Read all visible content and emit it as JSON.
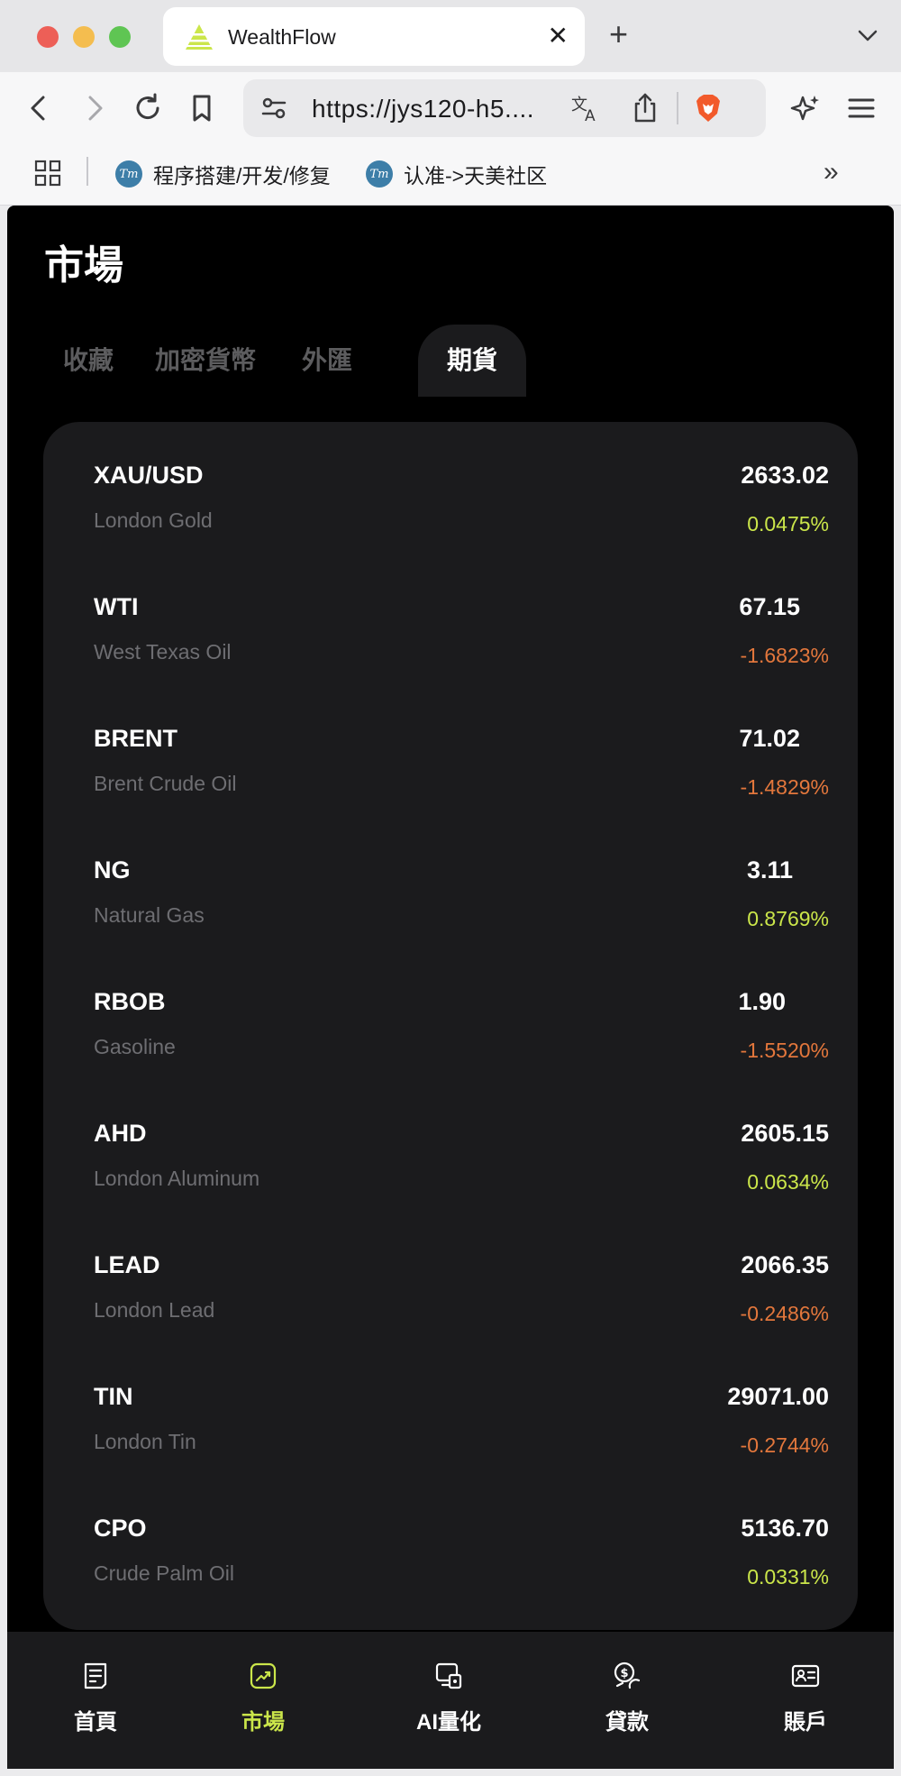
{
  "browser": {
    "tab_title": "WealthFlow",
    "url": "https://jys120-h5....",
    "bookmarks": [
      {
        "label": "程序搭建/开发/修复",
        "favicon_text": "Tm"
      },
      {
        "label": "认准->天美社区",
        "favicon_text": "Tm"
      }
    ]
  },
  "page": {
    "title": "市場",
    "tabs": [
      {
        "label": "收藏",
        "active": false
      },
      {
        "label": "加密貨幣",
        "active": false
      },
      {
        "label": "外匯",
        "active": false
      },
      {
        "label": "期貨",
        "active": true
      }
    ]
  },
  "colors": {
    "accent": "#cbe64a",
    "up": "#cbe64a",
    "down": "#e3773c",
    "background": "#000000",
    "card": "#1b1b1d"
  },
  "market": {
    "rows": [
      {
        "symbol": "XAU/USD",
        "name": "London Gold",
        "price": "2633.02",
        "change": "0.0475%",
        "direction": "up"
      },
      {
        "symbol": "WTI",
        "name": "West Texas Oil",
        "price": "67.15",
        "change": "-1.6823%",
        "direction": "down"
      },
      {
        "symbol": "BRENT",
        "name": "Brent Crude Oil",
        "price": "71.02",
        "change": "-1.4829%",
        "direction": "down"
      },
      {
        "symbol": "NG",
        "name": "Natural Gas",
        "price": "3.11",
        "change": "0.8769%",
        "direction": "up"
      },
      {
        "symbol": "RBOB",
        "name": "Gasoline",
        "price": "1.90",
        "change": "-1.5520%",
        "direction": "down"
      },
      {
        "symbol": "AHD",
        "name": "London Aluminum",
        "price": "2605.15",
        "change": "0.0634%",
        "direction": "up"
      },
      {
        "symbol": "LEAD",
        "name": "London Lead",
        "price": "2066.35",
        "change": "-0.2486%",
        "direction": "down"
      },
      {
        "symbol": "TIN",
        "name": "London Tin",
        "price": "29071.00",
        "change": "-0.2744%",
        "direction": "down"
      },
      {
        "symbol": "CPO",
        "name": "Crude Palm Oil",
        "price": "5136.70",
        "change": "0.0331%",
        "direction": "up"
      }
    ]
  },
  "bottom_nav": {
    "items": [
      {
        "label": "首頁",
        "icon": "home-icon",
        "active": false
      },
      {
        "label": "市場",
        "icon": "market-icon",
        "active": true
      },
      {
        "label": "AI量化",
        "icon": "ai-quant-icon",
        "active": false
      },
      {
        "label": "貸款",
        "icon": "loan-icon",
        "active": false
      },
      {
        "label": "賬戶",
        "icon": "account-icon",
        "active": false
      }
    ]
  }
}
